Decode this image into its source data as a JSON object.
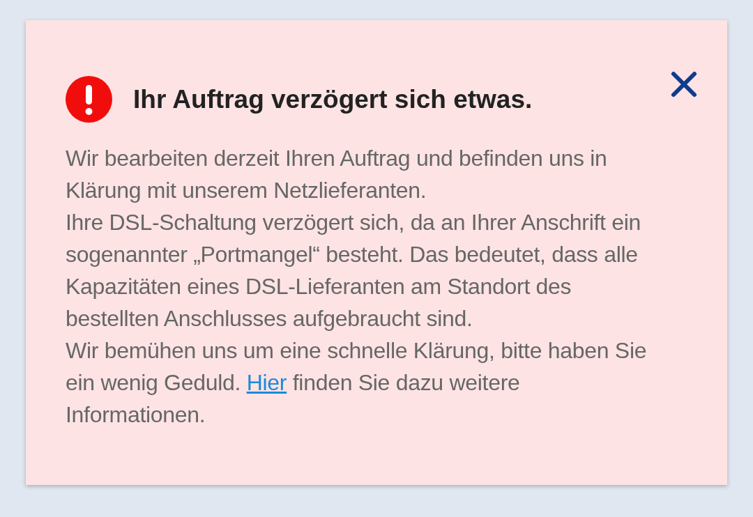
{
  "alert": {
    "title": "Ihr Auftrag verzögert sich etwas.",
    "paragraphs": [
      {
        "parts": [
          {
            "kind": "text",
            "text": "Wir bearbeiten derzeit Ihren Auftrag und befinden uns in Klärung mit unserem Netzlieferanten."
          }
        ]
      },
      {
        "parts": [
          {
            "kind": "text",
            "text": "Ihre DSL-Schaltung verzögert sich, da an Ihrer Anschrift ein sogenannter „Portmangel“ besteht. Das bedeutet, dass alle Kapazitäten eines DSL-Lieferanten am Standort des bestellten Anschlusses aufgebraucht sind."
          }
        ]
      },
      {
        "parts": [
          {
            "kind": "text",
            "text": "Wir bemühen uns um eine schnelle Klärung, bitte haben Sie ein wenig Geduld. "
          },
          {
            "kind": "link",
            "text": "Hier"
          },
          {
            "kind": "text",
            "text": " finden Sie dazu weitere Informationen."
          }
        ]
      }
    ]
  }
}
